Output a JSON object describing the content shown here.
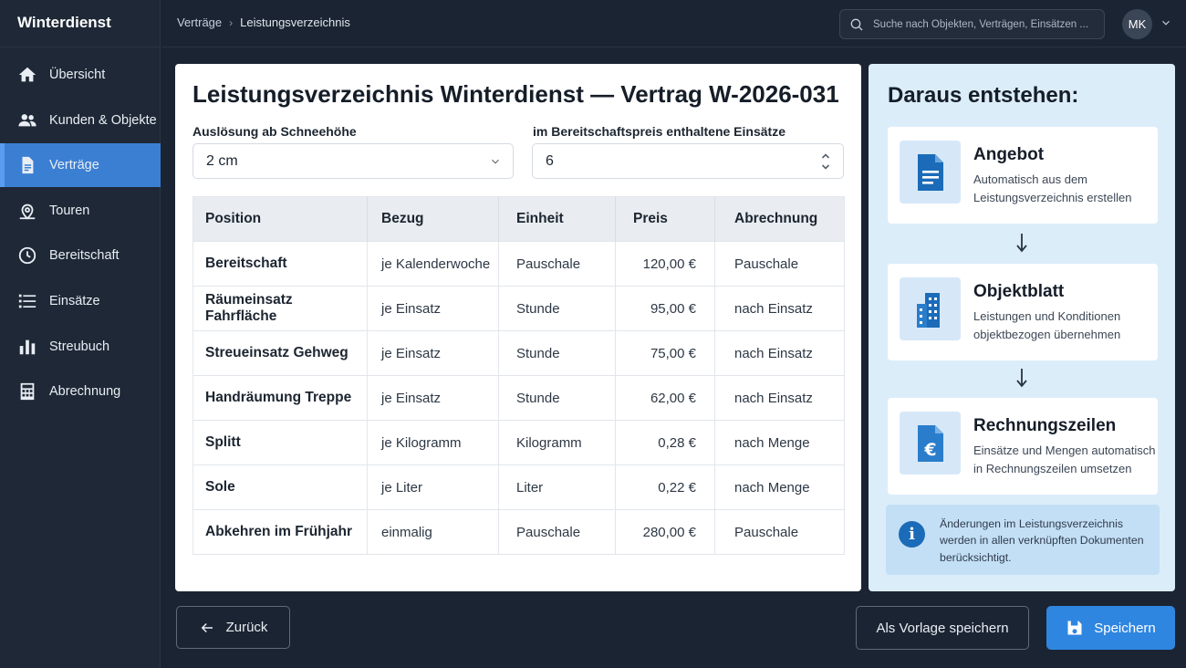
{
  "app": {
    "title": "Winterdienst"
  },
  "sidebar": {
    "items": [
      {
        "label": "Übersicht",
        "icon": "home-icon",
        "active": false
      },
      {
        "label": "Kunden & Objekte",
        "icon": "people-icon",
        "active": false
      },
      {
        "label": "Verträge",
        "icon": "document-icon",
        "active": true
      },
      {
        "label": "Touren",
        "icon": "map-pin-icon",
        "active": false
      },
      {
        "label": "Bereitschaft",
        "icon": "clock-icon",
        "active": false
      },
      {
        "label": "Einsätze",
        "icon": "list-icon",
        "active": false
      },
      {
        "label": "Streubuch",
        "icon": "bar-chart-icon",
        "active": false
      },
      {
        "label": "Abrechnung",
        "icon": "calculator-icon",
        "active": false
      }
    ]
  },
  "header": {
    "breadcrumb": [
      "Verträge",
      "Leistungsverzeichnis"
    ],
    "search_placeholder": "Suche nach Objekten, Verträgen, Einsätzen ...",
    "user_initials": "MK"
  },
  "main": {
    "title": "Leistungsverzeichnis Winterdienst — Vertrag W-2026-031",
    "trigger": {
      "label": "Auslösung ab Schneehöhe",
      "value": "2 cm"
    },
    "included": {
      "label": "im Bereitschaftspreis enthaltene Einsätze",
      "value": "6"
    },
    "table": {
      "headers": [
        "Position",
        "Bezug",
        "Einheit",
        "Preis",
        "Abrechnung"
      ],
      "rows": [
        [
          "Bereitschaft",
          "je Kalenderwoche",
          "Pauschale",
          "120,00 €",
          "Pauschale"
        ],
        [
          "Räumeinsatz Fahrfläche",
          "je Einsatz",
          "Stunde",
          "95,00 €",
          "nach Einsatz"
        ],
        [
          "Streueinsatz Gehweg",
          "je Einsatz",
          "Stunde",
          "75,00 €",
          "nach Einsatz"
        ],
        [
          "Handräumung Treppe",
          "je Einsatz",
          "Stunde",
          "62,00 €",
          "nach Einsatz"
        ],
        [
          "Splitt",
          "je Kilogramm",
          "Kilogramm",
          "0,28 €",
          "nach Menge"
        ],
        [
          "Sole",
          "je Liter",
          "Liter",
          "0,22 €",
          "nach Menge"
        ],
        [
          "Abkehren im Frühjahr",
          "einmalig",
          "Pauschale",
          "280,00 €",
          "Pauschale"
        ]
      ]
    }
  },
  "panel": {
    "title": "Daraus entstehen:",
    "steps": [
      {
        "title": "Angebot",
        "desc": "Automatisch aus dem Leistungsverzeichnis erstellen",
        "icon": "document-icon"
      },
      {
        "title": "Objektblatt",
        "desc": "Leistungen und Konditionen objektbezogen übernehmen",
        "icon": "building-icon"
      },
      {
        "title": "Rechnungszeilen",
        "desc": "Einsätze und Mengen automatisch in Rechnungszeilen umsetzen",
        "icon": "euro-document-icon"
      }
    ],
    "info": "Änderungen im Leistungsverzeichnis werden in allen verknüpften Dokumenten berücksichtigt."
  },
  "footer": {
    "back_label": "Zurück",
    "template_label": "Als Vorlage speichern",
    "save_label": "Speichern"
  },
  "colors": {
    "accent": "#2f86e0",
    "sidebar_active": "#3b7fd3",
    "panel_bg": "#dcedfa",
    "background": "#1b2432"
  }
}
